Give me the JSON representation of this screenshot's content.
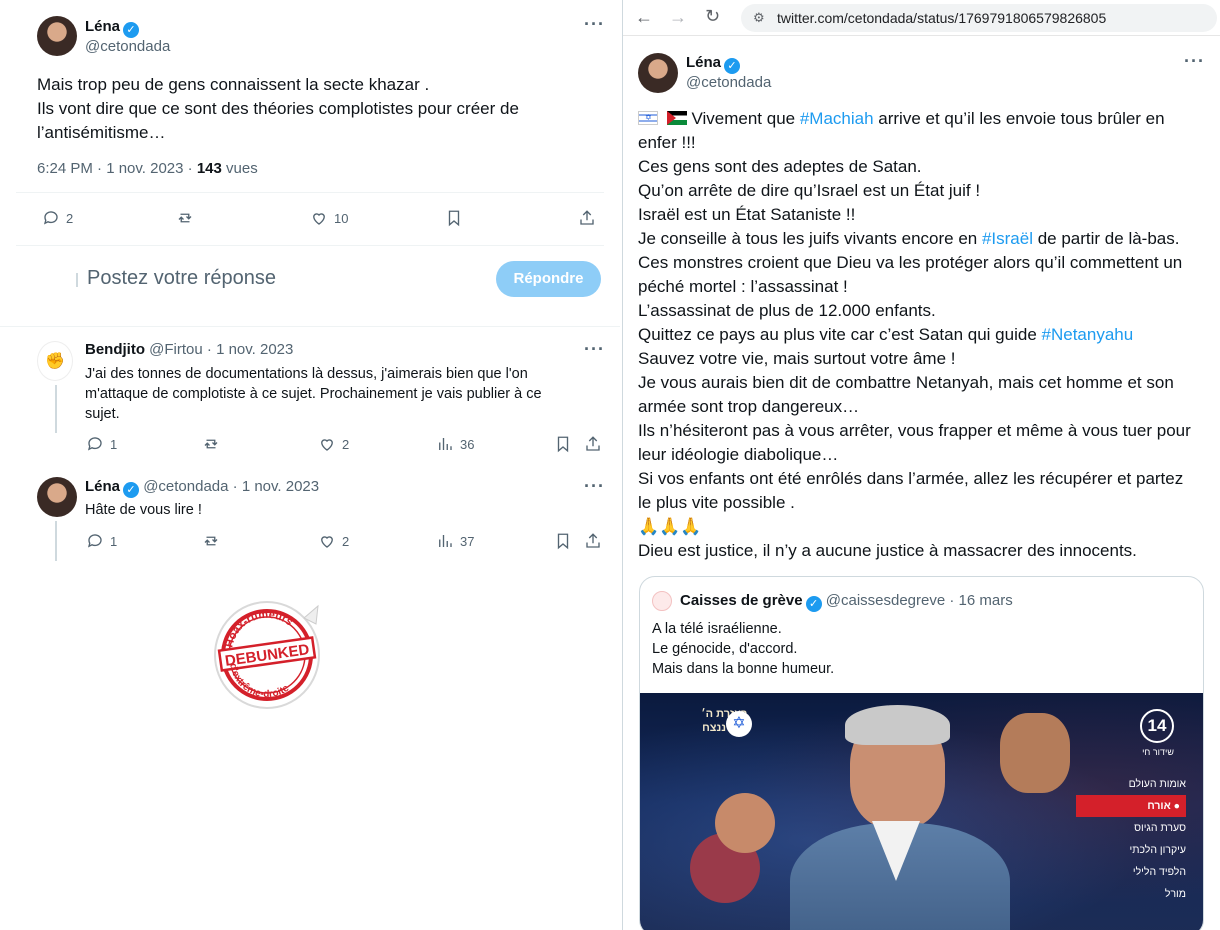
{
  "left_tweet": {
    "name": "Léna",
    "handle": "@cetondada",
    "text_lines": [
      "Mais trop peu de gens connaissent la secte khazar .",
      "Ils vont dire que ce sont des théories complotistes pour créer de",
      "l’antisémitisme…"
    ],
    "time": "6:24 PM · 1 nov. 2023 · ",
    "views": "143",
    "views_label": " vues",
    "replies": "2",
    "likes": "10",
    "reply_placeholder": "Postez votre réponse",
    "reply_button": "Répondre"
  },
  "replies": [
    {
      "name": "Bendjito",
      "handle": "@Firtou",
      "date": " · 1 nov. 2023",
      "text_lines": [
        "J'ai des tonnes de documentations là dessus, j'aimerais bien que l'on",
        "m'attaque de complotiste à ce sujet. Prochainement je vais publier à ce",
        "sujet."
      ],
      "replies": "1",
      "likes": "2",
      "views": "36"
    },
    {
      "name": "Léna",
      "handle": "@cetondada",
      "date": " · 1 nov. 2023",
      "text_lines": [
        "Hâte de vous lire !"
      ],
      "replies": "1",
      "likes": "2",
      "views": "37"
    }
  ],
  "browser": {
    "url": "twitter.com/cetondada/status/1769791806579826805"
  },
  "right_tweet": {
    "name": "Léna",
    "handle": "@cetondada",
    "flags": "🇮🇱 ",
    "line1_a": " Vivement que ",
    "line1_tag": "#Machiah",
    "line1_b": " arrive et qu’il les envoie tous brûler en",
    "line2": "enfer !!!",
    "line3": "Ces gens sont des adeptes de Satan.",
    "line4": "Qu’on arrête de dire qu’Israel est un État juif !",
    "line5": "Israël est un État Sataniste !!",
    "line6_a": "Je conseille à tous les juifs vivants encore en ",
    "line6_tag": "#Israël",
    "line6_b": " de partir de là-bas.",
    "line7": "Ces monstres croient que Dieu va les protéger alors qu’il commettent un",
    "line8": "péché mortel : l’assassinat !",
    "line9": "L’assassinat de plus de 12.000 enfants.",
    "line10_a": "Quittez ce pays au plus vite car c’est Satan qui guide ",
    "line10_tag": "#Netanyahu",
    "line11": "Sauvez votre vie, mais surtout votre âme !",
    "line12": "Je vous aurais bien dit de combattre Netanyah, mais cet homme et son",
    "line13": "armée sont trop dangereux…",
    "line14": "Ils n’hésiteront pas à vous arrêter, vous frapper et même à vous tuer pour",
    "line15": "leur idéologie diabolique…",
    "line16": "Si vos enfants ont été enrôlés dans l’armée, allez les récupérer et partez",
    "line17": "le plus vite possible .",
    "emojis": "🙏🙏🙏",
    "line18": "Dieu est justice, il n’y a aucune justice à massacrer des innocents."
  },
  "quoted_tweet": {
    "name": "Caisses de grève",
    "handle": "@caissesdegreve",
    "date": " · 16 mars",
    "text_lines": [
      "A la télé israélienne.",
      "Le génocide, d'accord.",
      "Mais dans la bonne humeur."
    ],
    "channel": "14",
    "channel_sub": "שידור חי",
    "banner": "בעזרת ה׳ \nיחד ננצח!",
    "menu": [
      "אומות העולם",
      "אורח",
      "סערת הגיוס",
      "עיקרון הלכתי",
      "הלפיד הלילי",
      "מורל"
    ]
  },
  "stamp": {
    "top": "Hoax-rumeurs",
    "middle": "DEBUNKED",
    "bottom": "d'extrême-droite"
  },
  "colors": {
    "accent": "#1d9bf0",
    "text": "#0f1419",
    "muted": "#536471",
    "stamp_red": "#d4202a"
  }
}
